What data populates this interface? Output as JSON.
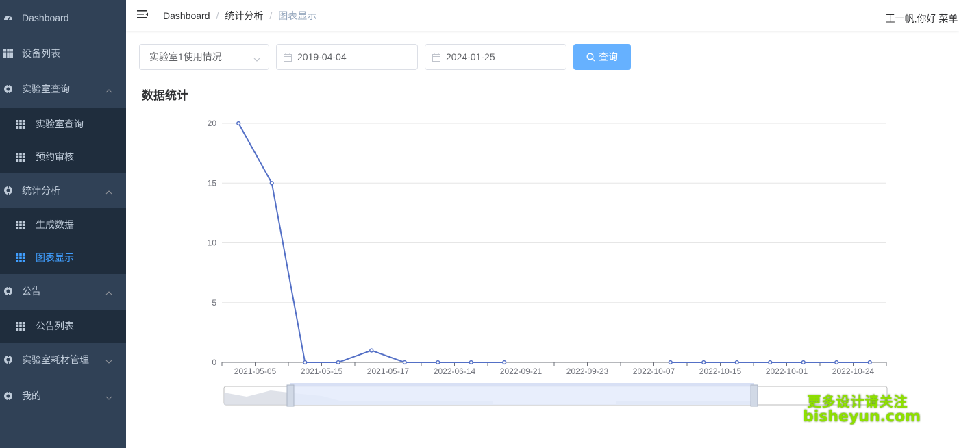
{
  "sidebar": {
    "items": [
      {
        "label": "Dashboard",
        "icon": "dashboard-icon",
        "level": 1
      },
      {
        "label": "设备列表",
        "icon": "table-icon",
        "level": 1
      },
      {
        "label": "实验室查询",
        "icon": "gear-icon",
        "level": 1,
        "expanded": true
      },
      {
        "label": "实验室查询",
        "icon": "table-icon",
        "level": 2
      },
      {
        "label": "预约审核",
        "icon": "table-icon",
        "level": 2
      },
      {
        "label": "统计分析",
        "icon": "gear-icon",
        "level": 1,
        "expanded": true
      },
      {
        "label": "生成数据",
        "icon": "table-icon",
        "level": 2
      },
      {
        "label": "图表显示",
        "icon": "table-icon",
        "level": 2,
        "active": true
      },
      {
        "label": "公告",
        "icon": "gear-icon",
        "level": 1,
        "expanded": true
      },
      {
        "label": "公告列表",
        "icon": "table-icon",
        "level": 2
      },
      {
        "label": "实验室耗材管理",
        "icon": "gear-icon",
        "level": 1,
        "expanded": false
      },
      {
        "label": "我的",
        "icon": "gear-icon",
        "level": 1,
        "expanded": false
      }
    ]
  },
  "header": {
    "breadcrumb": [
      "Dashboard",
      "统计分析",
      "图表显示"
    ],
    "user_text": "王一帆,你好 菜单 ±"
  },
  "filters": {
    "lab_select": "实验室1使用情况",
    "start_date": "2019-04-04",
    "end_date": "2024-01-25",
    "query_label": "查询"
  },
  "section_title": "数据统计",
  "colors": {
    "sidebar_bg": "#304156",
    "submenu_bg": "#1f2d3d",
    "menu_text": "#bfcbd9",
    "active": "#409eff",
    "line": "#5470c6",
    "button": "#66b1ff"
  },
  "chart_data": {
    "type": "line",
    "title": "",
    "xlabel": "",
    "ylabel": "",
    "ylim": [
      0,
      20
    ],
    "yticks": [
      0,
      5,
      10,
      15,
      20
    ],
    "x_tick_labels": [
      "2021-05-05",
      "2021-05-15",
      "2021-05-17",
      "2022-06-14",
      "2022-09-21",
      "2022-09-23",
      "2022-10-07",
      "2022-10-15",
      "2022-10-01",
      "2022-10-24"
    ],
    "series": [
      {
        "values": [
          20,
          15,
          0,
          0,
          1,
          0,
          0,
          0,
          0,
          null,
          null,
          null,
          null,
          0,
          0,
          0,
          0,
          0,
          0,
          0
        ]
      }
    ],
    "grid": true,
    "data_zoom_slider": true
  },
  "watermark": {
    "line1": "更多设计请关注",
    "line2": "bisheyun.com"
  }
}
